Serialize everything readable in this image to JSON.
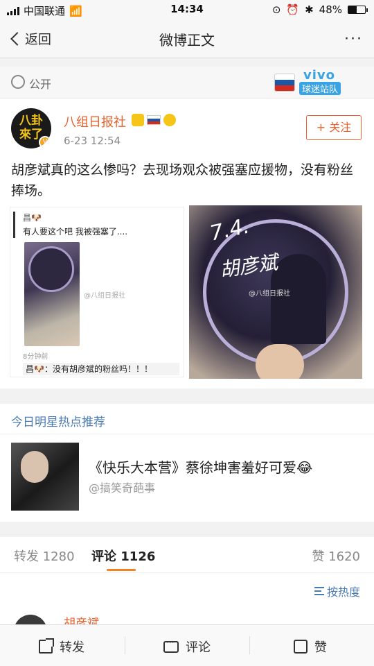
{
  "status_bar": {
    "carrier": "中国联通",
    "time": "14:34",
    "battery": "48%",
    "battery_level": 0.48
  },
  "nav": {
    "back_label": "返回",
    "title": "微博正文",
    "more": "···"
  },
  "visibility": {
    "label": "公开",
    "badge_brand": "vivo",
    "badge_team": "球迷站队"
  },
  "post": {
    "author": "八组日报社",
    "avatar_text": "八卦來了",
    "time": "6-23 12:54",
    "follow_label": "+ 关注",
    "text": "胡彦斌真的这么惨吗？去现场观众被强塞应援物，没有粉丝捧场。",
    "image_left": {
      "chat_head": "昌🐶",
      "chat_msg": "有人要这个吧 我被强塞了....",
      "watermark": "@八组日报社",
      "ago": "8分钟前",
      "reply": "昌🐶：没有胡彦斌的粉丝吗！！！"
    },
    "image_right": {
      "handwriting_1": "7.4.",
      "handwriting_2": "胡彦斌",
      "watermark": "@八组日报社"
    }
  },
  "hot": {
    "header": "今日明星热点推荐",
    "title": "《快乐大本营》蔡徐坤害羞好可爱😂",
    "source": "@搞笑奇葩事"
  },
  "tabs": {
    "repost": "转发 1280",
    "comment": "评论 1126",
    "like": "赞 1620"
  },
  "sort_label": "按热度",
  "comment_preview": {
    "name": "胡彦斌"
  },
  "bottom_bar": {
    "repost": "转发",
    "comment": "评论",
    "like": "赞"
  }
}
